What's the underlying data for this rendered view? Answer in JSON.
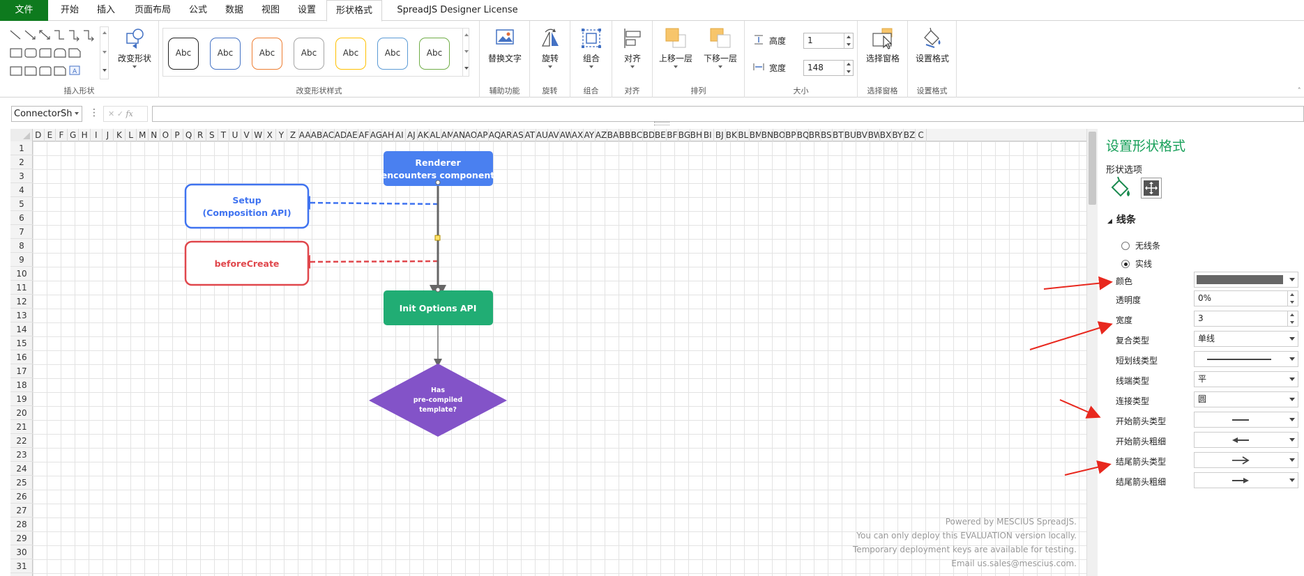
{
  "menu": {
    "file": "文件",
    "tabs": [
      "开始",
      "插入",
      "页面布局",
      "公式",
      "数据",
      "视图",
      "设置",
      "形状格式",
      "SpreadJS Designer License"
    ],
    "active": "形状格式"
  },
  "ribbon": {
    "insert_shape_group": "插入形状",
    "change_shape_button": "改变形状",
    "style_group": "改变形状样式",
    "style_samples": [
      {
        "label": "Abc",
        "color": "#222222"
      },
      {
        "label": "Abc",
        "color": "#4472c4"
      },
      {
        "label": "Abc",
        "color": "#ed7d31"
      },
      {
        "label": "Abc",
        "color": "#a5a5a5"
      },
      {
        "label": "Abc",
        "color": "#ffc000"
      },
      {
        "label": "Abc",
        "color": "#5b9bd5"
      },
      {
        "label": "Abc",
        "color": "#70ad47"
      }
    ],
    "alt_text_button": "替换文字",
    "accessibility_group": "辅助功能",
    "rotate_button": "旋转",
    "rotate_group": "旋转",
    "group_button": "组合",
    "group_group": "组合",
    "align_button": "对齐",
    "align_group": "对齐",
    "bring_forward_button": "上移一层",
    "send_backward_button": "下移一层",
    "arrange_group": "排列",
    "height_label": "高度",
    "height_value": "1",
    "width_label": "宽度",
    "width_value": "148",
    "size_group": "大小",
    "selection_pane_button": "选择窗格",
    "selection_pane_group": "选择窗格",
    "format_button": "设置格式",
    "format_group": "设置格式"
  },
  "formula_bar": {
    "name_box": "ConnectorSh",
    "fx": "fx",
    "formula": ""
  },
  "sheet": {
    "columns": [
      "D",
      "E",
      "F",
      "G",
      "H",
      "I",
      "J",
      "K",
      "L",
      "M",
      "N",
      "O",
      "P",
      "Q",
      "R",
      "S",
      "T",
      "U",
      "V",
      "W",
      "X",
      "Y",
      "Z",
      "AA",
      "AB",
      "AC",
      "AD",
      "AE",
      "AF",
      "AG",
      "AH",
      "AI",
      "AJ",
      "AK",
      "AL",
      "AM",
      "AN",
      "AO",
      "AP",
      "AQ",
      "AR",
      "AS",
      "AT",
      "AU",
      "AV",
      "AW",
      "AX",
      "AY",
      "AZ",
      "BA",
      "BB",
      "BC",
      "BD",
      "BE",
      "BF",
      "BG",
      "BH",
      "BI",
      "BJ",
      "BK",
      "BL",
      "BM",
      "BN",
      "BO",
      "BP",
      "BQ",
      "BR",
      "BS",
      "BT",
      "BU",
      "BV",
      "BW",
      "BX",
      "BY",
      "BZ",
      "C"
    ],
    "rows": [
      "1",
      "2",
      "3",
      "4",
      "5",
      "6",
      "7",
      "8",
      "9",
      "10",
      "11",
      "12",
      "13",
      "14",
      "15",
      "16",
      "17",
      "18",
      "19",
      "20",
      "21",
      "22",
      "23",
      "24",
      "25",
      "26",
      "27",
      "28",
      "29",
      "30",
      "31"
    ]
  },
  "shapes": {
    "renderer": {
      "line1": "Renderer",
      "line2": "encounters component",
      "fill": "#4a80f0"
    },
    "setup": {
      "line1": "Setup",
      "line2": "(Composition API)",
      "color": "#3f73f0"
    },
    "before_create": {
      "label": "beforeCreate",
      "color": "#e0474c"
    },
    "init_options": {
      "label": "Init Options API",
      "fill": "#21ad74"
    },
    "decision": {
      "line1": "Has",
      "line2": "pre-compiled",
      "line3": "template?",
      "fill": "#8353c8"
    }
  },
  "watermark": [
    "Powered by MESCIUS SpreadJS.",
    "You can only deploy this EVALUATION version locally.",
    "Temporary deployment keys are available for testing.",
    "Email us.sales@mescius.com."
  ],
  "panel": {
    "title": "设置形状格式",
    "title_color": "#18a05a",
    "shape_options": "形状选项",
    "section": "线条",
    "no_line": "无线条",
    "solid_line": "实线",
    "color_label": "颜色",
    "line_color": "#666666",
    "transparency_label": "透明度",
    "transparency_value": "0%",
    "width_label": "宽度",
    "width_value": "3",
    "compound_label": "复合类型",
    "compound_value": "单线",
    "dash_label": "短划线类型",
    "cap_label": "线端类型",
    "cap_value": "平",
    "join_label": "连接类型",
    "join_value": "圆",
    "begin_arrow_type_label": "开始箭头类型",
    "begin_arrow_size_label": "开始箭头粗细",
    "end_arrow_type_label": "结尾箭头类型",
    "end_arrow_size_label": "结尾箭头粗细"
  }
}
